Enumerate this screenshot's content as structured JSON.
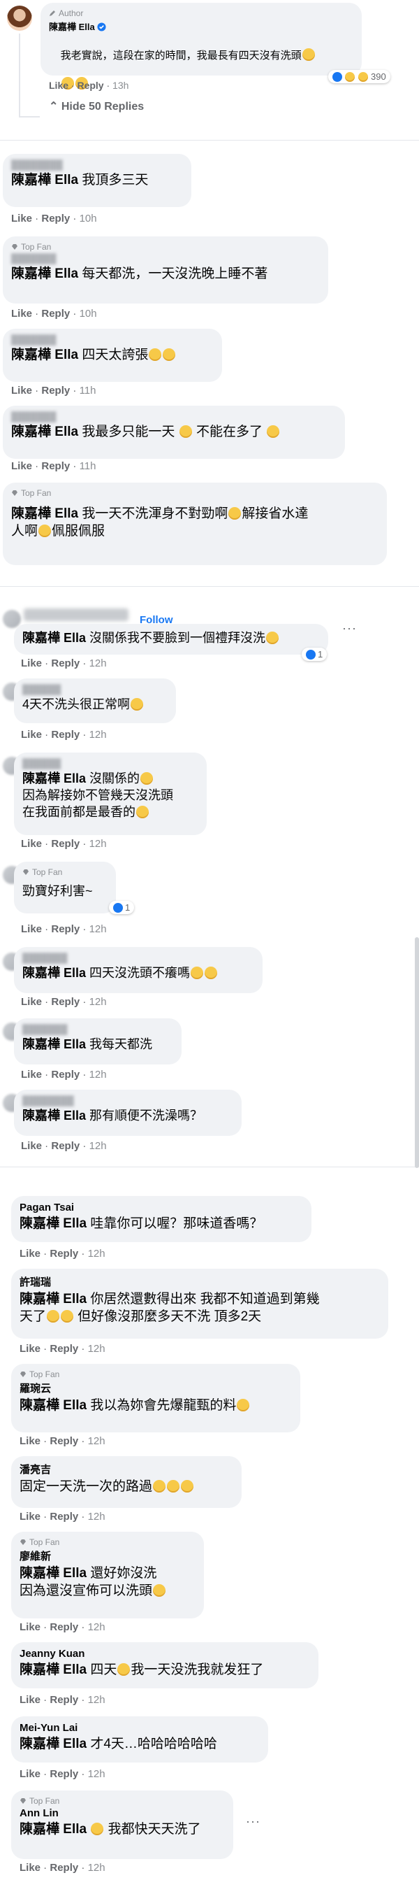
{
  "ui": {
    "like": "Like",
    "reply": "Reply",
    "dot": " · ",
    "more": "···"
  },
  "top": {
    "author_badge": "Author",
    "name": "陳嘉樺 Ella",
    "text": "我老實說，這段在家的時間，我最長有四天沒有洗頭",
    "reactions": "390",
    "time": "13h",
    "hide": "Hide 50 Replies"
  },
  "comments": [
    {
      "name": "",
      "tag": "陳嘉樺 Ella",
      "text": "我頂多三天",
      "time": "10h"
    },
    {
      "badge": "Top Fan",
      "name": "",
      "tag": "陳嘉樺 Ella",
      "text": "每天都洗，一天沒洗晚上睡不著",
      "time": "10h"
    },
    {
      "name": "",
      "tag": "陳嘉樺 Ella",
      "text": "四天太誇張",
      "time": "11h"
    },
    {
      "name": "",
      "tag": "陳嘉樺 Ella",
      "text": "我最多只能一天",
      "text2": "不能在多了",
      "time": "11h"
    },
    {
      "badge": "Top Fan",
      "name": "",
      "tag": "陳嘉樺 Ella",
      "text": "我一天不洗渾身不對勁啊",
      "text2": "解接省水達",
      "text3": "人啊",
      "text4": "佩服佩服",
      "time": ""
    },
    {
      "name": "",
      "follow": "Follow",
      "tag": "陳嘉樺 Ella",
      "text": "沒關係我不要臉到一個禮拜沒洗",
      "time": "12h",
      "reactions": "1"
    },
    {
      "name": "",
      "tag": "",
      "text": "4天不洗头很正常啊",
      "time": "12h"
    },
    {
      "name": "",
      "tag": "陳嘉樺 Ella",
      "text": "沒關係的",
      "line2": "因為解接妳不管幾天沒洗頭",
      "line3": "在我面前都是最香的",
      "time": "12h"
    },
    {
      "badge": "Top Fan",
      "name": "",
      "tag": "",
      "text": "勁寶好利害~",
      "time": "12h",
      "reactions": "1"
    },
    {
      "name": "",
      "tag": "陳嘉樺 Ella",
      "text": "四天沒洗頭不癢嗎",
      "time": "12h"
    },
    {
      "name": "",
      "tag": "陳嘉樺 Ella",
      "text": "我每天都洗",
      "time": "12h"
    },
    {
      "name": "",
      "tag": "陳嘉樺 Ella",
      "text": "那有順便不洗澡嗎？",
      "time": "12h"
    },
    {
      "name": "Pagan Tsai",
      "tag": "陳嘉樺 Ella",
      "text": "哇靠你可以喔？那味道香嗎？",
      "time": "12h"
    },
    {
      "name": "許瑞瑞",
      "tag": "陳嘉樺 Ella",
      "text": "你居然還數得出來 我都不知道過到第幾",
      "line2": "天了",
      "line2b": "但好像沒那麼多天不洗 頂多2天",
      "time": "12h"
    },
    {
      "badge": "Top Fan",
      "name": "羅琬云",
      "tag": "陳嘉樺 Ella",
      "text": "我以為妳會先爆龍甄的料",
      "time": "12h"
    },
    {
      "name": "潘亮吉",
      "tag": "",
      "text": "固定一天洗一次的路過",
      "time": "12h"
    },
    {
      "badge": "Top Fan",
      "name": "廖維新",
      "tag": "陳嘉樺 Ella",
      "text": "還好妳沒洗",
      "line2": "因為還沒宣佈可以洗頭",
      "time": "12h"
    },
    {
      "name": "Jeanny Kuan",
      "tag": "陳嘉樺 Ella",
      "text": "四天",
      "text2": "我一天没洗我就发狂了",
      "time": "12h"
    },
    {
      "name": "Mei-Yun Lai",
      "tag": "陳嘉樺 Ella",
      "text": "才4天…哈哈哈哈哈哈",
      "time": "12h"
    },
    {
      "badge": "Top Fan",
      "name": "Ann Lin",
      "tag": "陳嘉樺 Ella",
      "text": "我都快天天洗了",
      "time": "12h"
    }
  ]
}
